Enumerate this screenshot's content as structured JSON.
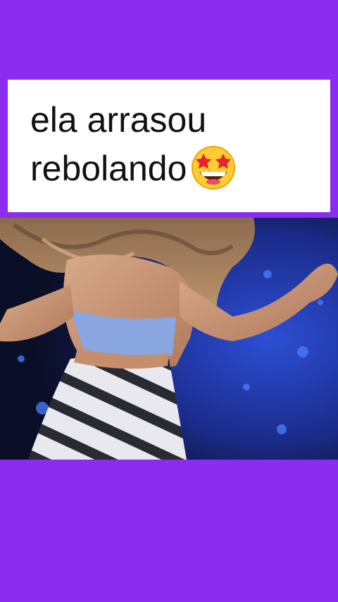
{
  "caption": {
    "line1": "ela arrasou",
    "line2": "rebolando",
    "emoji_icon": "star-struck-emoji-icon"
  },
  "colors": {
    "background": "#8b2cf0",
    "caption_background": "#ffffff",
    "caption_text": "#111111"
  },
  "video": {
    "description_icon": "video-frame"
  }
}
